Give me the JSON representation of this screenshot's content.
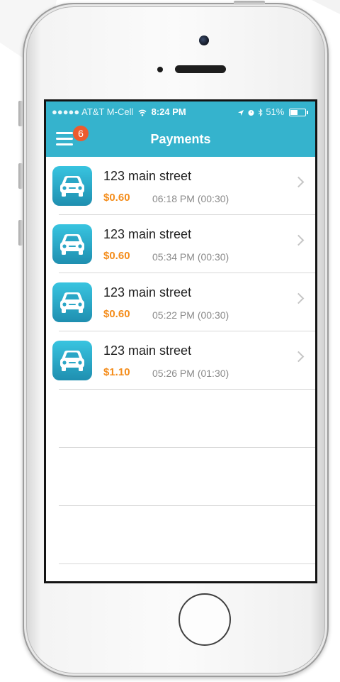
{
  "status_bar": {
    "carrier": "●●●●● AT&T M-Cell",
    "wifi_icon": "wifi-icon",
    "time": "8:24 PM",
    "location_icon": "location-arrow-icon",
    "alarm_icon": "alarm-icon",
    "bluetooth_icon": "bluetooth-icon",
    "battery_percent": "51%",
    "battery_level": 0.51
  },
  "nav": {
    "title": "Payments",
    "menu_icon": "hamburger-menu-icon",
    "badge_count": "6"
  },
  "colors": {
    "accent": "#35b3cd",
    "badge": "#ec5b2e",
    "price": "#f48d1c"
  },
  "payments": [
    {
      "address": "123 main street",
      "amount": "$0.60",
      "time": "06:18 PM (00:30)"
    },
    {
      "address": "123 main street",
      "amount": "$0.60",
      "time": "05:34 PM (00:30)"
    },
    {
      "address": "123 main street",
      "amount": "$0.60",
      "time": "05:22 PM (00:30)"
    },
    {
      "address": "123 main street",
      "amount": "$1.10",
      "time": "05:26 PM (01:30)"
    }
  ]
}
